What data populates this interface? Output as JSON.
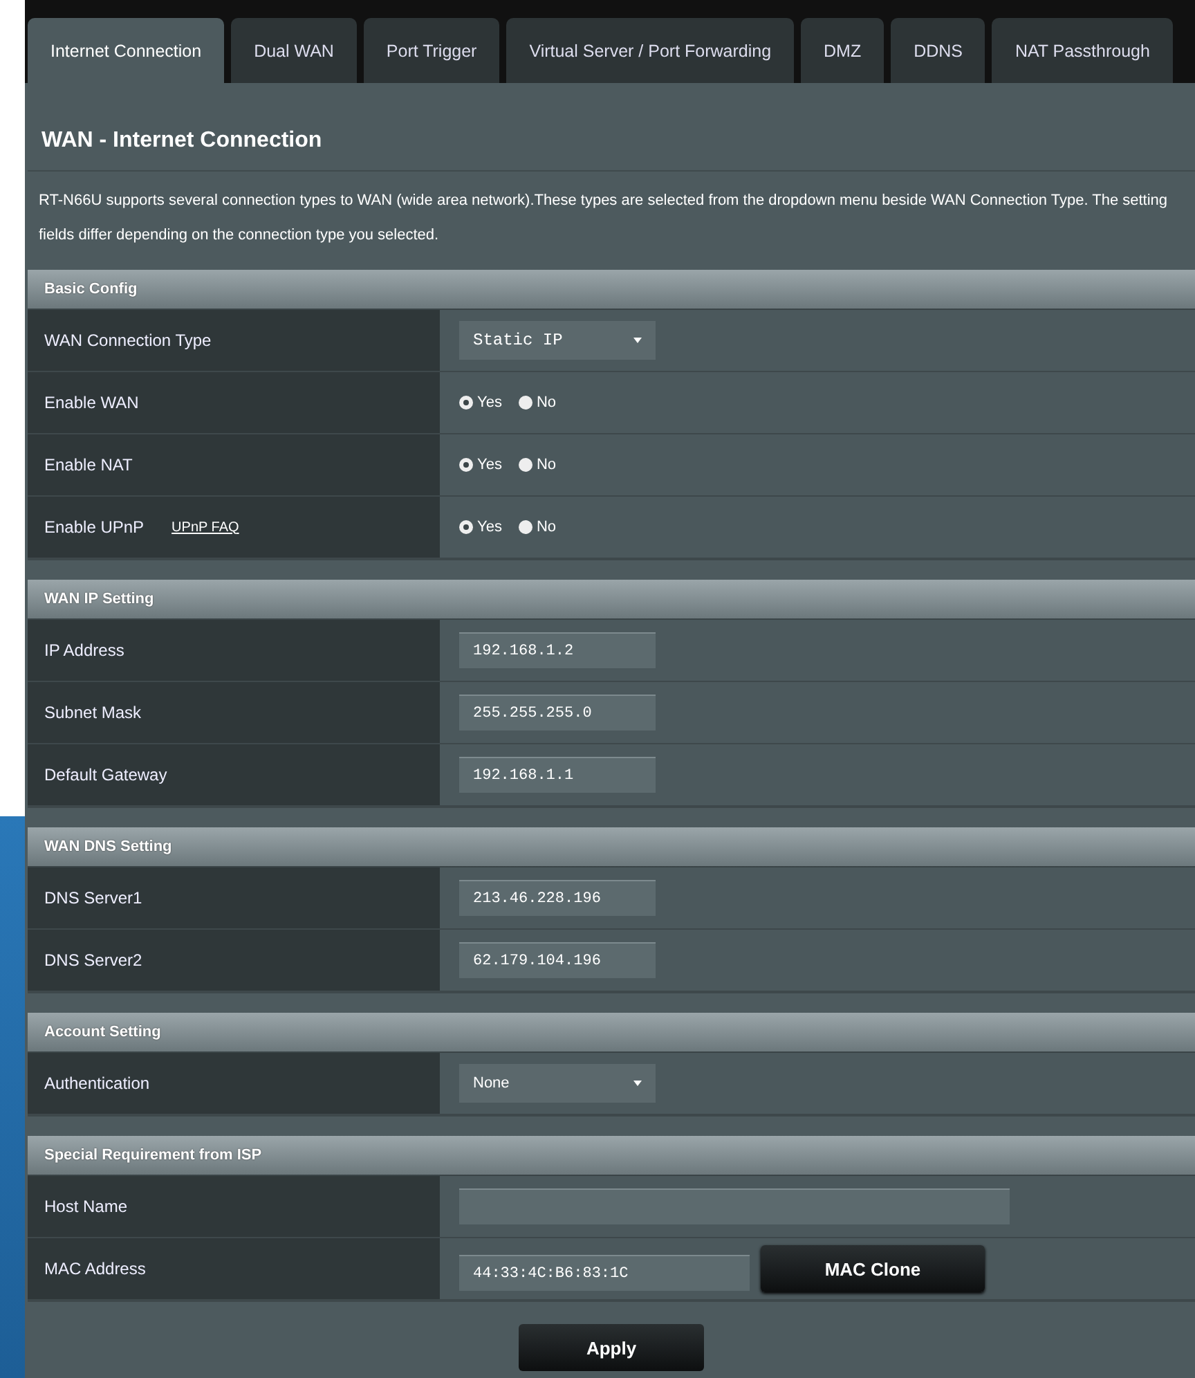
{
  "tabs": [
    {
      "label": "Internet Connection",
      "selected": true
    },
    {
      "label": "Dual WAN",
      "selected": false
    },
    {
      "label": "Port Trigger",
      "selected": false
    },
    {
      "label": "Virtual Server / Port Forwarding",
      "selected": false
    },
    {
      "label": "DMZ",
      "selected": false
    },
    {
      "label": "DDNS",
      "selected": false
    },
    {
      "label": "NAT Passthrough",
      "selected": false
    }
  ],
  "title": "WAN - Internet Connection",
  "description": "RT-N66U supports several connection types to WAN (wide area network).These types are selected from the dropdown menu beside WAN Connection Type. The setting fields differ depending on the connection type you selected.",
  "sections": [
    {
      "title": "Basic Config",
      "rows": [
        {
          "kind": "select",
          "label": "WAN Connection Type",
          "value": "Static IP",
          "mono": true
        },
        {
          "kind": "radio",
          "label": "Enable WAN",
          "options": [
            {
              "label": "Yes",
              "selected": true
            },
            {
              "label": "No",
              "selected": false
            }
          ]
        },
        {
          "kind": "radio",
          "label": "Enable NAT",
          "options": [
            {
              "label": "Yes",
              "selected": true
            },
            {
              "label": "No",
              "selected": false
            }
          ]
        },
        {
          "kind": "radio",
          "label": "Enable UPnP",
          "link": "UPnP  FAQ",
          "options": [
            {
              "label": "Yes",
              "selected": true
            },
            {
              "label": "No",
              "selected": false
            }
          ]
        }
      ]
    },
    {
      "title": "WAN IP Setting",
      "rows": [
        {
          "kind": "text",
          "label": "IP Address",
          "value": "192.168.1.2"
        },
        {
          "kind": "text",
          "label": "Subnet Mask",
          "value": "255.255.255.0"
        },
        {
          "kind": "text",
          "label": "Default Gateway",
          "value": "192.168.1.1"
        }
      ]
    },
    {
      "title": "WAN DNS Setting",
      "rows": [
        {
          "kind": "text",
          "label": "DNS Server1",
          "value": "213.46.228.196"
        },
        {
          "kind": "text",
          "label": "DNS Server2",
          "value": "62.179.104.196"
        }
      ]
    },
    {
      "title": "Account Setting",
      "rows": [
        {
          "kind": "select",
          "label": "Authentication",
          "value": "None",
          "mono": false
        }
      ]
    },
    {
      "title": "Special Requirement from ISP",
      "rows": [
        {
          "kind": "wide_text",
          "label": "Host Name"
        },
        {
          "kind": "text_button",
          "label": "MAC Address",
          "value": "44:33:4C:B6:83:1C",
          "button": "MAC Clone"
        }
      ]
    }
  ],
  "apply": "Apply"
}
